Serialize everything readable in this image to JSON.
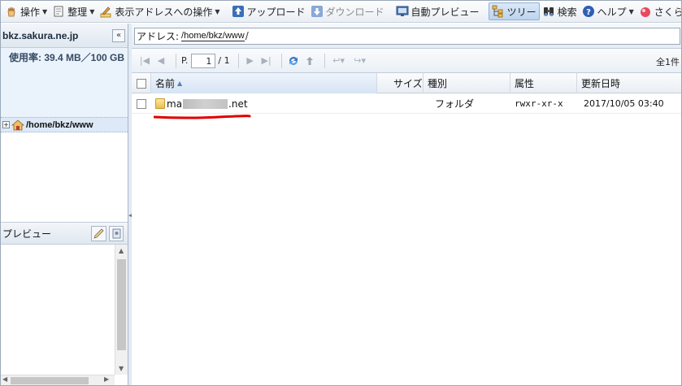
{
  "toolbar": {
    "items": [
      {
        "label": "操作",
        "icon": "hand-icon",
        "dropdown": true
      },
      {
        "label": "整理",
        "icon": "document-icon",
        "dropdown": true
      },
      {
        "label": "表示アドレスへの操作",
        "icon": "pencil-icon",
        "dropdown": true
      },
      {
        "label": "アップロード",
        "icon": "upload-icon"
      },
      {
        "label": "ダウンロード",
        "icon": "download-icon",
        "disabled": true
      },
      {
        "label": "自動プレビュー",
        "icon": "monitor-icon"
      },
      {
        "label": "ツリー",
        "icon": "tree-icon",
        "active": true
      },
      {
        "label": "検索",
        "icon": "binoculars-icon"
      },
      {
        "label": "ヘルプ",
        "icon": "help-icon",
        "dropdown": true
      },
      {
        "label": "さくら",
        "icon": "sakura-icon",
        "dropdown": true
      }
    ]
  },
  "sidebar": {
    "server": "bkz.sakura.ne.jp",
    "collapse": "«",
    "usage": "使用率: 39.4 MB／100 GB",
    "tree": {
      "toggle": "+",
      "label": "/home/bkz/www"
    },
    "preview_title": "プレビュー"
  },
  "address": {
    "label": "アドレス:",
    "value": "/home/bkz/www"
  },
  "pager": {
    "page_prefix": "P.",
    "page": "1",
    "page_total": "/ 1",
    "count": "全1件"
  },
  "grid": {
    "columns": [
      "名前",
      "サイズ",
      "種別",
      "属性",
      "更新日時"
    ],
    "sort_indicator": "▲",
    "rows": [
      {
        "name_prefix": "ma",
        "name_suffix": ".net",
        "size": "",
        "type": "フォルダ",
        "attr": "rwxr-xr-x",
        "date": "2017/10/05 03:40"
      }
    ]
  },
  "colors": {
    "highlight_underline": "#e00000",
    "folder": "#e8bf4f",
    "accent": "#3b6fb6"
  }
}
